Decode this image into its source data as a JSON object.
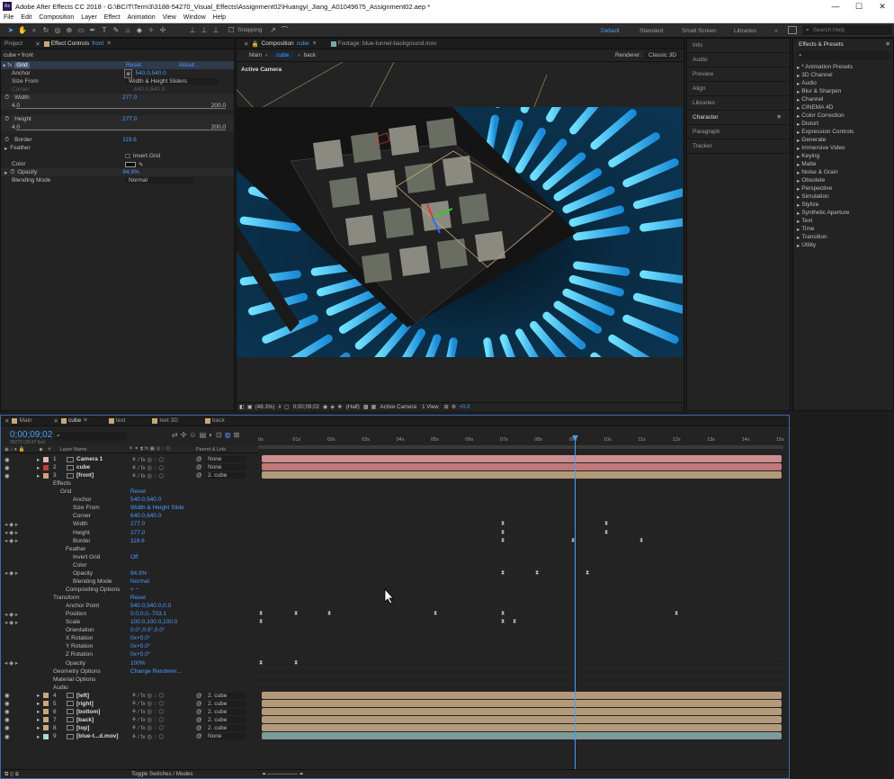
{
  "window": {
    "title": "Adobe After Effects CC 2018 - G:\\BCIT\\Term3\\3188-54270_Visual_Effects\\Assignment02\\Huangyi_Jiang_A01049675_Assignment02.aep *",
    "min": "—",
    "max": "☐",
    "close": "✕",
    "app_badge": "Ae"
  },
  "menu": [
    "File",
    "Edit",
    "Composition",
    "Layer",
    "Effect",
    "Animation",
    "View",
    "Window",
    "Help"
  ],
  "toolbar": {
    "snapping": "Snapping",
    "workspaces": [
      "Default",
      "Standard",
      "Small Screen",
      "Libraries"
    ],
    "search_placeholder": "Search Help",
    "more": "»"
  },
  "project_panel": {
    "tab_project": "Project",
    "tab_effect_controls": "Effect Controls",
    "layer_name": "front",
    "breadcrumb": "cube • front"
  },
  "effect_controls": {
    "fx_label": "fx",
    "effect_name": "Grid",
    "reset": "Reset",
    "about": "About...",
    "rows": [
      {
        "label": "Anchor",
        "value": "540.0,540.0"
      },
      {
        "label": "Size From",
        "value": "Width & Height Sliders"
      },
      {
        "label": "Corner",
        "value": "640.0,640.0"
      },
      {
        "label": "Width",
        "value": "277.0"
      },
      {
        "label": "Height",
        "value": "277.0"
      },
      {
        "label": "Border",
        "value": "119.6"
      },
      {
        "label": "Feather",
        "value": ""
      },
      {
        "label": "Invert Grid",
        "value": ""
      },
      {
        "label": "Color",
        "value": ""
      },
      {
        "label": "Opacity",
        "value": "94.9%"
      },
      {
        "label": "Blending Mode",
        "value": "Normal"
      }
    ],
    "slider_min": "4.0",
    "slider_max": "200.0"
  },
  "composition": {
    "tab_label": "Composition",
    "comp_name": "cube",
    "footage_tab": "Footage: blue-tunnel-background.mov",
    "crumbs": [
      "Main",
      "cube",
      "back"
    ],
    "renderer_label": "Renderer:",
    "renderer": "Classic 3D",
    "view_label": "Active Camera"
  },
  "viewer_footer": {
    "zoom": "(48.3%)",
    "timecode": "0;00;09;02",
    "resolution": "(Half)",
    "camera": "Active Camera",
    "views": "1 View",
    "exposure": "+0.0"
  },
  "right_panel": [
    "Info",
    "Audio",
    "Preview",
    "Align",
    "Libraries",
    "Character",
    "Paragraph",
    "Tracker"
  ],
  "effects_presets": {
    "title": "Effects & Presets",
    "search_placeholder": "",
    "items": [
      "* Animation Presets",
      "3D Channel",
      "Audio",
      "Blur & Sharpen",
      "Channel",
      "CINEMA 4D",
      "Color Correction",
      "Distort",
      "Expression Controls",
      "Generate",
      "Immersive Video",
      "Keying",
      "Matte",
      "Noise & Grain",
      "Obsolete",
      "Perspective",
      "Simulation",
      "Stylize",
      "Synthetic Aperture",
      "Text",
      "Time",
      "Transition",
      "Utility"
    ]
  },
  "timeline": {
    "tabs": [
      "Main",
      "cube",
      "text",
      "text 3D",
      "back"
    ],
    "timecode": "0;00;09;02",
    "timecode_sub": "00272 (29.97 fps)",
    "header": {
      "source": "Layer Name",
      "parent": "Parent & Link"
    },
    "ruler": [
      "0s",
      "01s",
      "02s",
      "03s",
      "04s",
      "05s",
      "06s",
      "07s",
      "08s",
      "09s",
      "10s",
      "11s",
      "12s",
      "13s",
      "14s",
      "15s"
    ],
    "layers_top": [
      {
        "num": "1",
        "name": "Camera 1",
        "parent": "None",
        "color": "#e8b4b4"
      },
      {
        "num": "2",
        "name": "cube",
        "parent": "None",
        "color": "#c0403f"
      },
      {
        "num": "3",
        "name": "[front]",
        "parent": "2. cube",
        "color": "#c8a77a"
      }
    ],
    "props": [
      {
        "label": "Effects",
        "value": ""
      },
      {
        "label": "Grid",
        "value": "Reset"
      },
      {
        "label": "Anchor",
        "value": "540.0,540.0"
      },
      {
        "label": "Size From",
        "value": "Width & Height Slide"
      },
      {
        "label": "Corner",
        "value": "640.0,640.0"
      },
      {
        "label": "Width",
        "value": "277.0"
      },
      {
        "label": "Height",
        "value": "277.0"
      },
      {
        "label": "Border",
        "value": "119.6"
      },
      {
        "label": "Feather",
        "value": ""
      },
      {
        "label": "Invert Grid",
        "value": "Off"
      },
      {
        "label": "Color",
        "value": ""
      },
      {
        "label": "Opacity",
        "value": "94.9%"
      },
      {
        "label": "Blending Mode",
        "value": "Normal"
      },
      {
        "label": "Compositing Options",
        "value": "+ −"
      },
      {
        "label": "Transform",
        "value": "Reset"
      },
      {
        "label": "Anchor Point",
        "value": "540.0,540.0,0.0"
      },
      {
        "label": "Position",
        "value": "0.0,0.0,-703.1"
      },
      {
        "label": "Scale",
        "value": "100.0,100.0,100.0"
      },
      {
        "label": "Orientation",
        "value": "0.0°,0.0°,0.0°"
      },
      {
        "label": "X Rotation",
        "value": "0x+0.0°"
      },
      {
        "label": "Y Rotation",
        "value": "0x+0.0°"
      },
      {
        "label": "Z Rotation",
        "value": "0x+0.0°"
      },
      {
        "label": "Opacity",
        "value": "100%"
      },
      {
        "label": "Geometry Options",
        "value": "Change Renderer..."
      },
      {
        "label": "Material Options",
        "value": ""
      },
      {
        "label": "Audio",
        "value": ""
      }
    ],
    "layers_bottom": [
      {
        "num": "4",
        "name": "[left]",
        "parent": "2. cube",
        "color": "#c8a77a"
      },
      {
        "num": "5",
        "name": "[right]",
        "parent": "2. cube",
        "color": "#c8a77a"
      },
      {
        "num": "6",
        "name": "[bottom]",
        "parent": "2. cube",
        "color": "#c8a77a"
      },
      {
        "num": "7",
        "name": "[back]",
        "parent": "2. cube",
        "color": "#c8a77a"
      },
      {
        "num": "8",
        "name": "[top]",
        "parent": "2. cube",
        "color": "#c8a77a"
      },
      {
        "num": "9",
        "name": "[blue-t...d.mov]",
        "parent": "None",
        "color": "#a8d8d8"
      }
    ],
    "toggle_label": "Toggle Switches / Modes"
  },
  "colors": {
    "accent": "#4a9cff",
    "tan": "#c8a77a"
  }
}
